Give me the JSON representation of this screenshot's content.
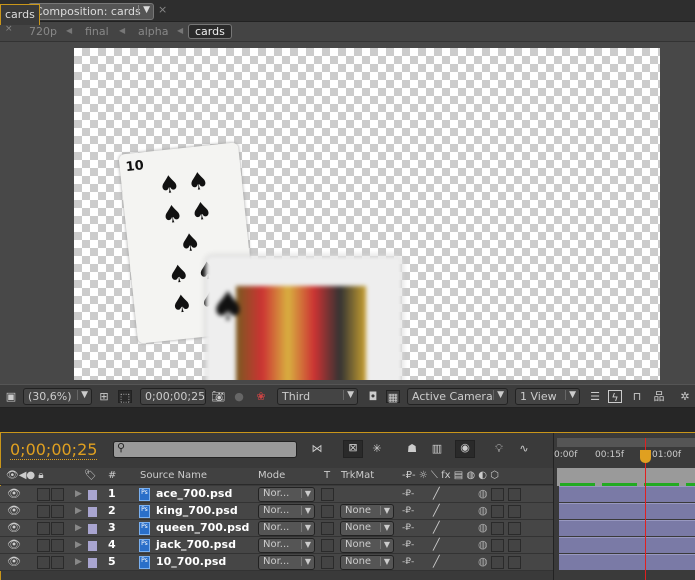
{
  "composition_tab": {
    "label": "Composition: cards",
    "close": "×"
  },
  "breadcrumbs": [
    "720p",
    "final",
    "alpha",
    "cards"
  ],
  "viewer_toolbar": {
    "zoom": "(30,6%)",
    "timecode": "0;00;00;25",
    "renderer": "Third",
    "camera": "Active Camera",
    "views": "1 View"
  },
  "timeline": {
    "tab_label": "cards",
    "tab_close": "×",
    "current_time": "0;00;00;25",
    "search_placeholder": "",
    "ruler": [
      "0:00f",
      "00:15f",
      "01:00f"
    ],
    "columns": {
      "number": "#",
      "source_name": "Source Name",
      "mode": "Mode",
      "t": "T",
      "trkmat": "TrkMat"
    },
    "layers": [
      {
        "num": "1",
        "name": "ace_700.psd",
        "mode": "Nor...",
        "trkmat": ""
      },
      {
        "num": "2",
        "name": "king_700.psd",
        "mode": "Nor...",
        "trkmat": "None"
      },
      {
        "num": "3",
        "name": "queen_700.psd",
        "mode": "Nor...",
        "trkmat": "None"
      },
      {
        "num": "4",
        "name": "jack_700.psd",
        "mode": "Nor...",
        "trkmat": "None"
      },
      {
        "num": "5",
        "name": "10_700.psd",
        "mode": "Nor...",
        "trkmat": "None"
      }
    ],
    "card_text": "10",
    "colors": {
      "accent": "#e0a020",
      "label": "#a9a5d0",
      "layer_bar": "#7a7aa6",
      "playhead": "#e02020"
    }
  }
}
